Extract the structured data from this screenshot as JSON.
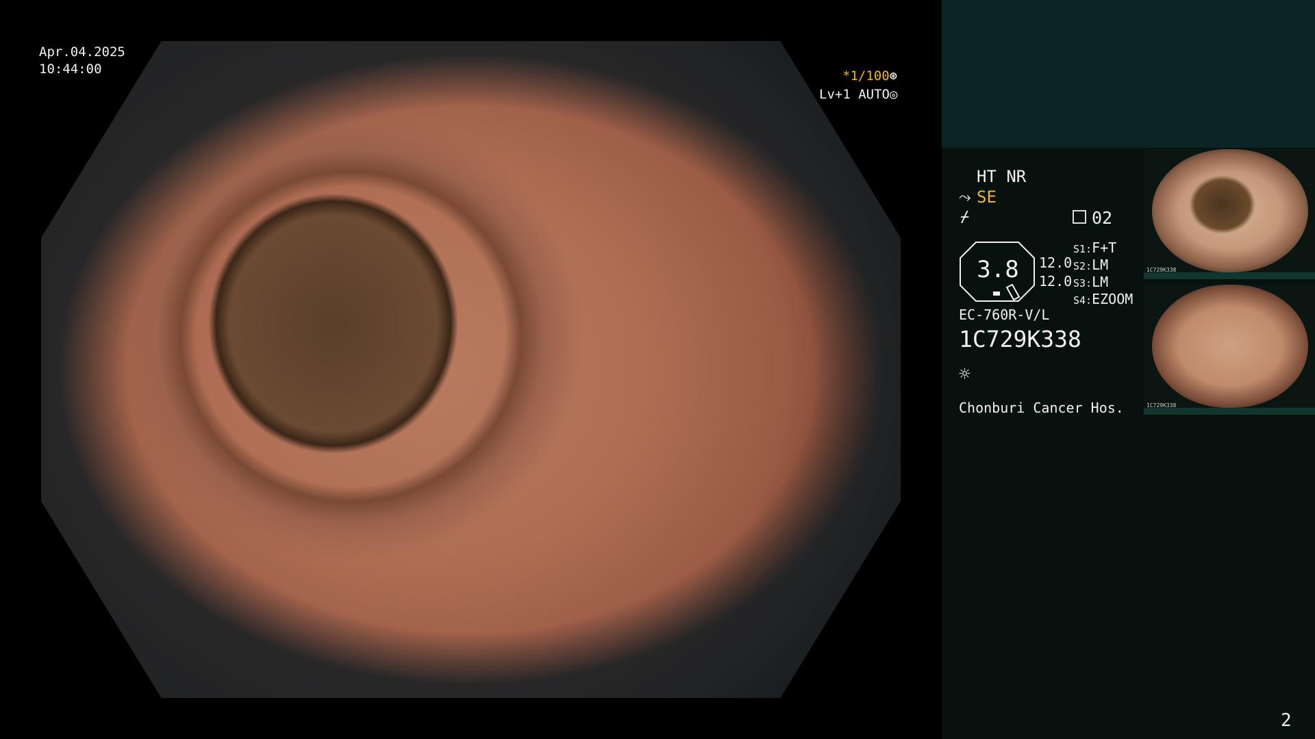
{
  "overlay": {
    "date": "Apr.04.2025",
    "time": "10:44:00",
    "shutter": "*1/100",
    "level": "Lv+1 AUTO"
  },
  "panel": {
    "ht_nr": "HT NR",
    "se": "SE",
    "seg_value": "02",
    "zoom": "3.8",
    "ratio1": "12.0",
    "ratio2": "12.0",
    "settings": [
      {
        "label": "S1:",
        "value": "F+T"
      },
      {
        "label": "S2:",
        "value": "LM"
      },
      {
        "label": "S3:",
        "value": "LM"
      },
      {
        "label": "S4:",
        "value": "EZOOM"
      }
    ],
    "model": "EC-760R-V/L",
    "serial": "1C729K338",
    "hospital": "Chonburi Cancer Hos."
  },
  "thumbnails": [
    {
      "id": "1C729K338"
    },
    {
      "id": "1C729K338"
    }
  ],
  "page_number": "2",
  "colors": {
    "accent": "#f2b42a",
    "panel_top": "#0c2426",
    "panel_bottom": "#07120f"
  }
}
